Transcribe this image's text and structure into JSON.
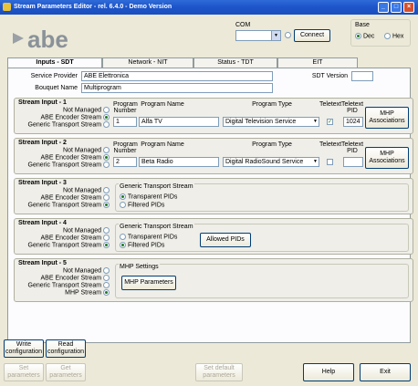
{
  "window": {
    "title": "Stream Parameters Editor - rel. 6.4.0 - Demo Version"
  },
  "logo": {
    "text": "abe"
  },
  "com": {
    "label": "COM",
    "value": "",
    "connect_label": "Connect"
  },
  "base": {
    "label": "Base",
    "options": [
      "Dec",
      "Hex"
    ],
    "selected": "Dec"
  },
  "tabs": [
    "Inputs - SDT",
    "Network - NIT",
    "Status - TDT",
    "EIT"
  ],
  "sdt": {
    "service_provider_label": "Service Provider",
    "service_provider_value": "ABE Elettronica",
    "bouquet_label": "Bouquet Name",
    "bouquet_value": "Multiprogram",
    "version_label": "SDT Version",
    "version_value": ""
  },
  "mode_labels": {
    "not_managed": "Not Managed",
    "abe_encoder": "ABE Encoder Stream",
    "generic_ts": "Generic Transport Stream",
    "mhp": "MHP Stream"
  },
  "col_labels": {
    "program_number": "Program Number",
    "program_name": "Program Name",
    "program_type": "Program Type",
    "teletext": "Teletext",
    "teletext_pid": "Teletext PID"
  },
  "inputs": [
    {
      "title": "Stream Input - 1",
      "program_number": "1",
      "program_name": "Alfa TV",
      "program_type": "Digital Television Service",
      "teletext_pid": "1024",
      "mhp_button": "MHP Associations"
    },
    {
      "title": "Stream Input - 2",
      "program_number": "2",
      "program_name": "Beta Radio",
      "program_type": "Digital RadioSound Service",
      "teletext_pid": "",
      "mhp_button": "MHP Associations"
    },
    {
      "title": "Stream Input - 3",
      "gts_title": "Generic Transport Stream",
      "opt_transparent": "Transparent PIDs",
      "opt_filtered": "Filtered PIDs"
    },
    {
      "title": "Stream Input - 4",
      "gts_title": "Generic Transport Stream",
      "opt_transparent": "Transparent PIDs",
      "opt_filtered": "Filtered PIDs",
      "allowed_button": "Allowed PIDs"
    },
    {
      "title": "Stream Input - 5",
      "mhp_title": "MHP Settings",
      "mhp_button": "MHP Parameters"
    }
  ],
  "bottom": {
    "write_config": "Write configuration",
    "read_config": "Read configuration",
    "set_params": "Set parameters",
    "get_params": "Get parameters",
    "set_default": "Set default parameters",
    "help": "Help",
    "exit": "Exit"
  }
}
